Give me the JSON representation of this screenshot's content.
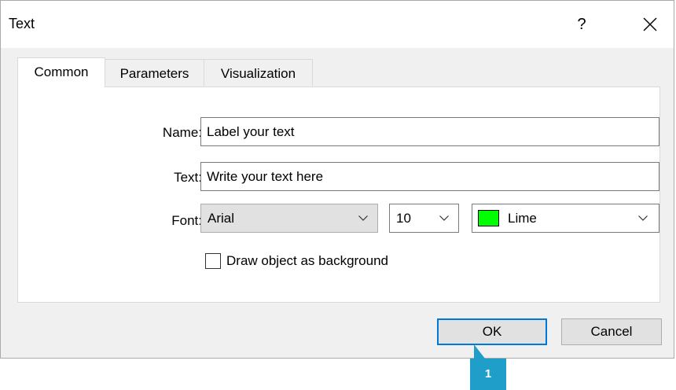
{
  "dialog": {
    "title": "Text",
    "help_glyph": "?",
    "close_icon": "close-icon"
  },
  "tabs": [
    {
      "label": "Common",
      "active": true
    },
    {
      "label": "Parameters",
      "active": false
    },
    {
      "label": "Visualization",
      "active": false
    }
  ],
  "form": {
    "name_label": "Name:",
    "name_value": "Label your text",
    "text_label": "Text:",
    "text_value": "Write your text here",
    "font_label": "Font:",
    "font_value": "Arial",
    "size_value": "10",
    "color_value": "Lime",
    "color_hex": "#00ff00",
    "background_checkbox_label": "Draw object as background",
    "background_checked": false
  },
  "buttons": {
    "ok_label": "OK",
    "cancel_label": "Cancel"
  },
  "annotation": {
    "marker_label": "1",
    "marker_color": "#1e9ec8"
  }
}
